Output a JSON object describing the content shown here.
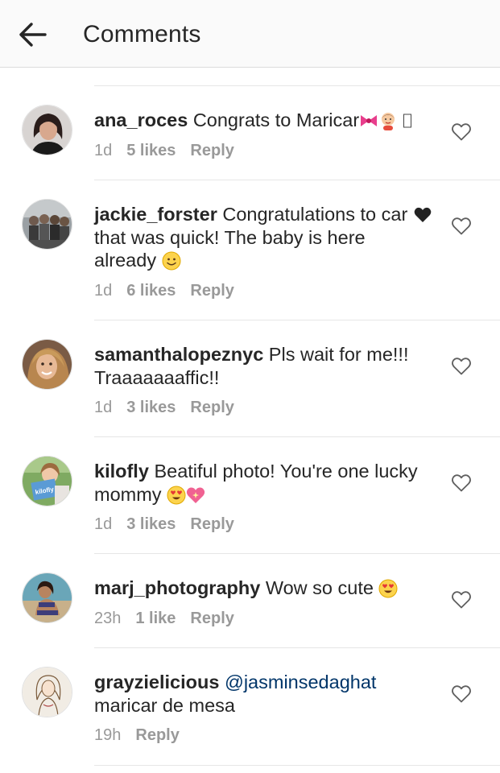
{
  "header": {
    "title": "Comments",
    "back_icon": "arrow-left-icon"
  },
  "comments": [
    {
      "username": "ana_roces",
      "text": "Congrats to Maricar",
      "time": "1d",
      "likes": "5 likes",
      "reply": "Reply"
    },
    {
      "username": "jackie_forster",
      "text_a": "Congratulations to car",
      "text_b": "that was quick! The baby is here already",
      "time": "1d",
      "likes": "6 likes",
      "reply": "Reply"
    },
    {
      "username": "samanthalopeznyc",
      "text": "Pls wait for me!!! Traaaaaaaffic!!",
      "time": "1d",
      "likes": "3 likes",
      "reply": "Reply"
    },
    {
      "username": "kilofly",
      "text": "Beatiful photo! You're one lucky mommy",
      "avatar_label": "kilofly",
      "time": "1d",
      "likes": "3 likes",
      "reply": "Reply"
    },
    {
      "username": "marj_photography",
      "text": "Wow so cute",
      "time": "23h",
      "likes": "1 like",
      "reply": "Reply"
    },
    {
      "username": "grayzielicious",
      "mention": "@jasminsedaghat",
      "text": "maricar de mesa",
      "time": "19h",
      "reply": "Reply"
    }
  ],
  "icons": {
    "like": "heart-outline-icon",
    "emoji": [
      "ribbon-emoji",
      "baby-emoji",
      "black-heart-emoji",
      "smiling-face-emoji",
      "heart-eyes-emoji",
      "sparkling-heart-emoji"
    ]
  },
  "colors": {
    "text": "#262626",
    "meta": "#999999",
    "mention": "#003569",
    "divider": "#e6e6e6",
    "header_bg": "#fafafa"
  }
}
